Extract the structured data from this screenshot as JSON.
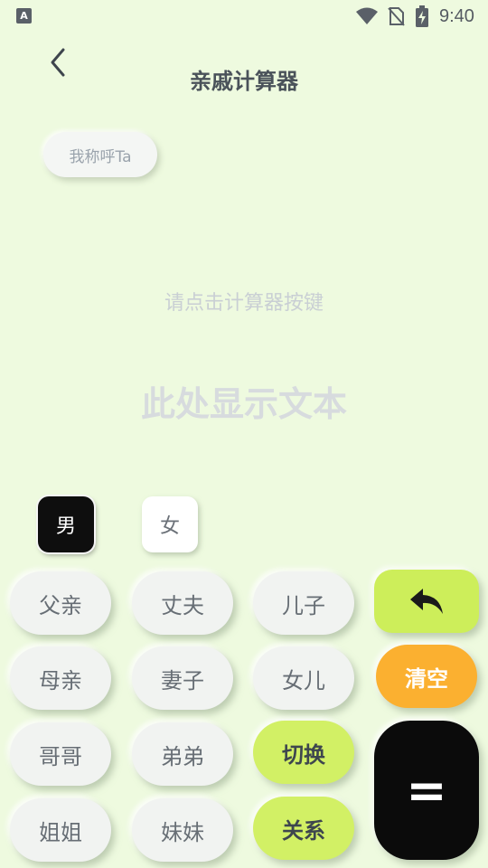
{
  "status_bar": {
    "time": "9:40",
    "app_badge": "A"
  },
  "header": {
    "title": "亲戚计算器"
  },
  "chip": {
    "label": "我称呼Ta"
  },
  "display": {
    "hint": "请点击计算器按键",
    "result": "此处显示文本"
  },
  "gender": {
    "male": "男",
    "female": "女"
  },
  "keys": {
    "father": "父亲",
    "husband": "丈夫",
    "son": "儿子",
    "mother": "母亲",
    "wife": "妻子",
    "daughter": "女儿",
    "clear": "清空",
    "elder_brother": "哥哥",
    "younger_brother": "弟弟",
    "switch": "切换",
    "elder_sister": "姐姐",
    "younger_sister": "妹妹",
    "relation": "关系",
    "equals": "="
  },
  "icons": {
    "back": "chevron-left-icon",
    "undo": "reply-arrow-icon",
    "wifi": "wifi-icon",
    "sim": "no-sim-icon",
    "battery": "battery-charging-icon"
  },
  "colors": {
    "background": "#eefadf",
    "accent_green": "#d2f065",
    "clear_orange": "#fbb030",
    "equals_black": "#0b0b0b"
  }
}
